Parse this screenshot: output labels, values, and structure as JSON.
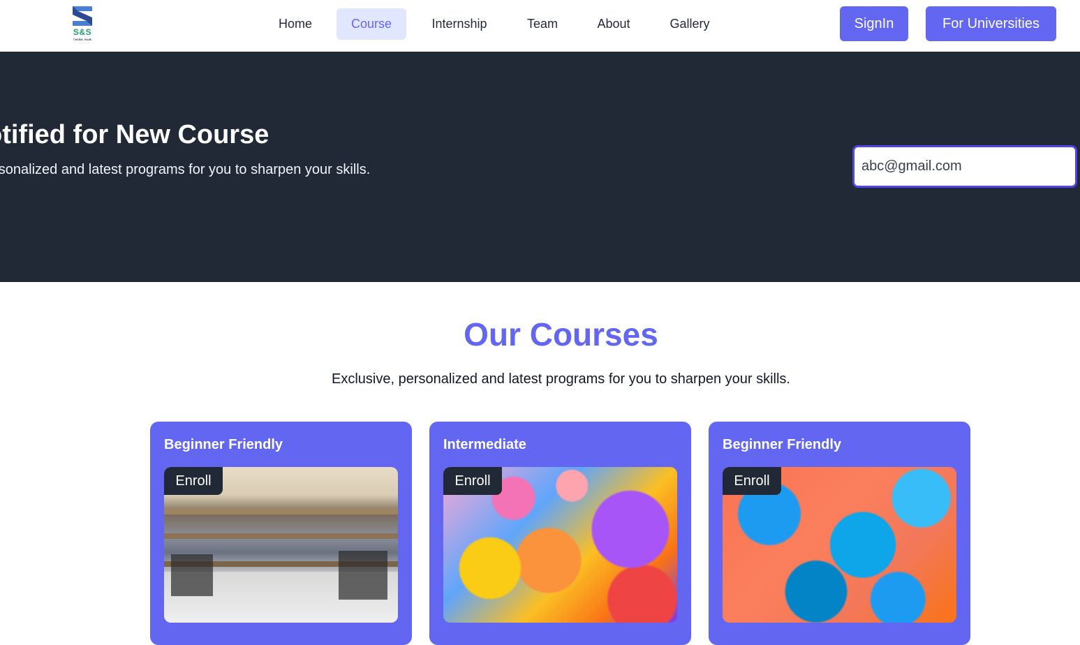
{
  "logo": {
    "text": "S&S",
    "subtext": "THINK HUB",
    "color": "#1f9e6e"
  },
  "nav": {
    "items": [
      {
        "label": "Home",
        "active": false
      },
      {
        "label": "Course",
        "active": true
      },
      {
        "label": "Internship",
        "active": false
      },
      {
        "label": "Team",
        "active": false
      },
      {
        "label": "About",
        "active": false
      },
      {
        "label": "Gallery",
        "active": false
      }
    ],
    "signin_label": "SignIn",
    "universities_label": "For Universities"
  },
  "hero": {
    "title": "otified for New Course",
    "subtitle": "ersonalized and latest programs for you to sharpen your skills.",
    "email_value": "abc@gmail.com"
  },
  "courses": {
    "title": "Our Courses",
    "subtitle": "Exclusive, personalized and latest programs for you to sharpen your skills.",
    "cards": [
      {
        "level": "Beginner Friendly",
        "enroll_label": "Enroll",
        "image": "classroom-photo"
      },
      {
        "level": "Intermediate",
        "enroll_label": "Enroll",
        "image": "colorful-bubbles-photo"
      },
      {
        "level": "Beginner Friendly",
        "enroll_label": "Enroll",
        "image": "marble-paint-photo"
      }
    ]
  },
  "colors": {
    "accent": "#6366f1",
    "accent_light": "#e0e7ff",
    "hero_bg": "#212937",
    "input_border": "#4f46e5"
  }
}
